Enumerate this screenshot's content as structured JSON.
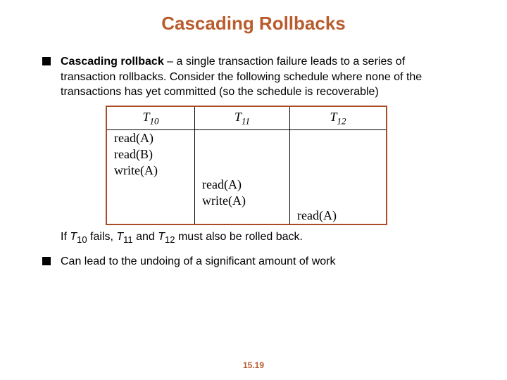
{
  "title": "Cascading Rollbacks",
  "bullets": {
    "b1": {
      "term": "Cascading rollback",
      "rest": " – a single transaction failure leads to a series of transaction rollbacks.  Consider the following schedule where none of the transactions has yet committed (so the schedule is recoverable)"
    },
    "after": {
      "pre": "If ",
      "t10": "T",
      "t10sub": "10",
      "mid1": " fails, ",
      "t11": "T",
      "t11sub": "11",
      "mid2": " and ",
      "t12": "T",
      "t12sub": "12",
      "post": " must also be rolled back."
    },
    "b2": "Can lead to the undoing of a significant amount of work"
  },
  "table": {
    "headers": {
      "h1": "T",
      "h1sub": "10",
      "h2": "T",
      "h2sub": "11",
      "h3": "T",
      "h3sub": "12"
    },
    "col1": {
      "r1": "read(A)",
      "r2": "read(B)",
      "r3": "write(A)"
    },
    "col2": {
      "r1": "read(A)",
      "r2": "write(A)"
    },
    "col3": {
      "r1": "read(A)"
    }
  },
  "footer": "15.19"
}
